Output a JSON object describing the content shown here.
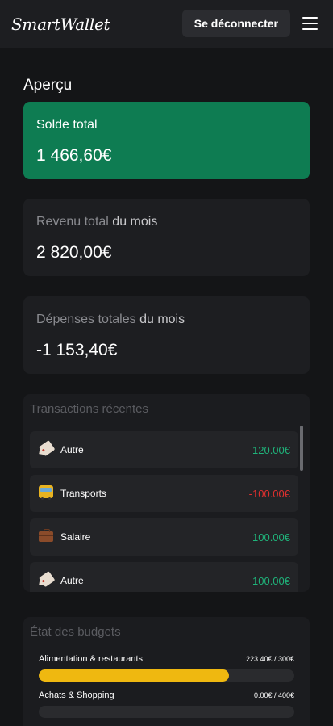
{
  "header": {
    "logo": "SmartWallet",
    "logout_label": "Se déconnecter"
  },
  "page": {
    "title": "Aperçu"
  },
  "balance": {
    "label": "Solde total",
    "value": "1 466,60€"
  },
  "income": {
    "label_dim": "Revenu total",
    "label_rest": " du mois",
    "value": "2 820,00€"
  },
  "expenses": {
    "label_dim": "Dépenses totales",
    "label_rest": " du mois",
    "value": "-1 153,40€"
  },
  "transactions": {
    "title": "Transactions récentes",
    "items": [
      {
        "icon": "tag-icon",
        "name": "Autre",
        "amount": "120.00€",
        "type": "positive"
      },
      {
        "icon": "bus-icon",
        "name": "Transports",
        "amount": "-100.00€",
        "type": "negative"
      },
      {
        "icon": "briefcase-icon",
        "name": "Salaire",
        "amount": "100.00€",
        "type": "positive"
      },
      {
        "icon": "tag-icon",
        "name": "Autre",
        "amount": "100.00€",
        "type": "positive"
      }
    ]
  },
  "budgets": {
    "title": "État des budgets",
    "items": [
      {
        "name": "Alimentation & restaurants",
        "value": "223.40€ / 300€",
        "progress": 0.745
      },
      {
        "name": "Achats & Shopping",
        "value": "0.00€ / 400€",
        "progress": 0
      }
    ]
  },
  "colors": {
    "balance_card": "#0e7c52",
    "positive": "#1fb37a",
    "negative": "#e0302f",
    "budget_fill": "#efb810"
  }
}
